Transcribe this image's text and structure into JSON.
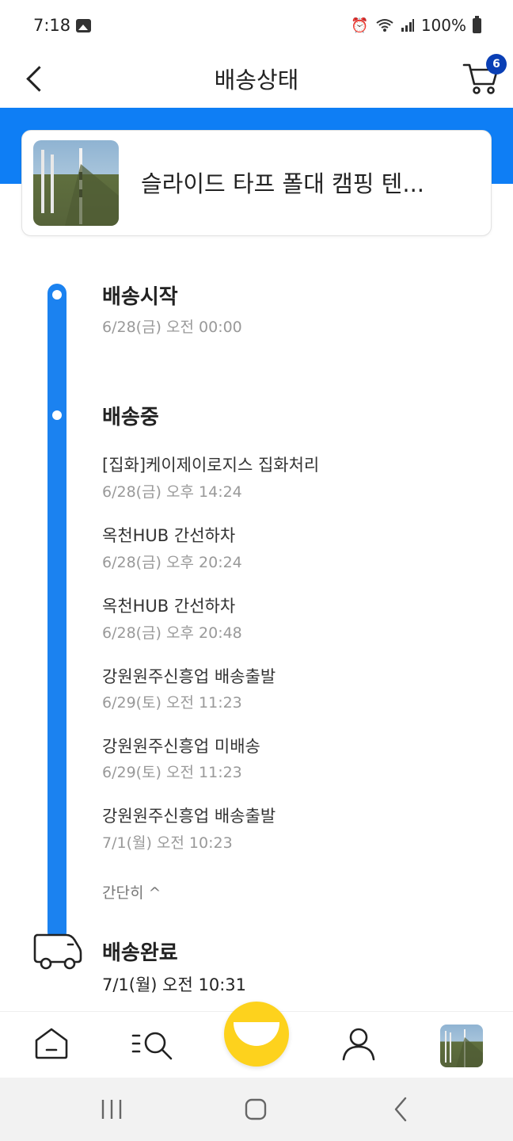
{
  "status_bar": {
    "time": "7:18",
    "battery": "100%"
  },
  "header": {
    "title": "배송상태",
    "cart_count": "6"
  },
  "product": {
    "name": "슬라이드 타프 폴대 캠핑 텐..."
  },
  "timeline": {
    "start": {
      "title": "배송시작",
      "time": "6/28(금) 오전 00:00"
    },
    "transit": {
      "title": "배송중",
      "events": [
        {
          "label": "[집화]케이제이로지스 집화처리",
          "time": "6/28(금) 오후 14:24"
        },
        {
          "label": "옥천HUB 간선하차",
          "time": "6/28(금) 오후 20:24"
        },
        {
          "label": "옥천HUB 간선하차",
          "time": "6/28(금) 오후 20:48"
        },
        {
          "label": "강원원주신흥업 배송출발",
          "time": "6/29(토) 오전 11:23"
        },
        {
          "label": "강원원주신흥업 미배송",
          "time": "6/29(토) 오전 11:23"
        },
        {
          "label": "강원원주신흥업 배송출발",
          "time": "7/1(월) 오전 10:23"
        }
      ],
      "collapse_label": "간단히 ^"
    },
    "complete": {
      "title": "배송완료",
      "time": "7/1(월) 오전 10:31"
    }
  },
  "colors": {
    "accent": "#0e7ef5",
    "badge": "#0a3fb5",
    "center_button": "#fdd21d"
  },
  "icons": [
    "back-icon",
    "cart-icon",
    "home-icon",
    "search-list-icon",
    "smile-icon",
    "profile-icon",
    "truck-icon"
  ]
}
